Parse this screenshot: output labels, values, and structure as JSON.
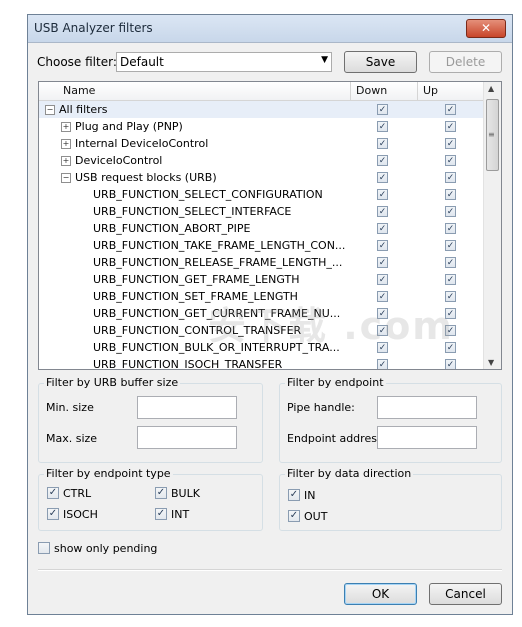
{
  "window": {
    "title": "USB Analyzer filters",
    "close_glyph": "✕"
  },
  "filter": {
    "label": "Choose filter:",
    "value": "Default",
    "save": "Save",
    "delete": "Delete"
  },
  "tree": {
    "columns": [
      "Name",
      "Down",
      "Up"
    ],
    "rows": [
      {
        "label": "All filters",
        "indent": 0,
        "expander": "−",
        "down": true,
        "up": true,
        "selected": true
      },
      {
        "label": "Plug and Play (PNP)",
        "indent": 1,
        "expander": "+",
        "down": true,
        "up": true
      },
      {
        "label": "Internal DeviceIoControl",
        "indent": 1,
        "expander": "+",
        "down": true,
        "up": true
      },
      {
        "label": "DeviceIoControl",
        "indent": 1,
        "expander": "+",
        "down": true,
        "up": true
      },
      {
        "label": "USB request blocks (URB)",
        "indent": 1,
        "expander": "−",
        "down": true,
        "up": true
      },
      {
        "label": "URB_FUNCTION_SELECT_CONFIGURATION",
        "indent": 2,
        "expander": "",
        "down": true,
        "up": true
      },
      {
        "label": "URB_FUNCTION_SELECT_INTERFACE",
        "indent": 2,
        "expander": "",
        "down": true,
        "up": true
      },
      {
        "label": "URB_FUNCTION_ABORT_PIPE",
        "indent": 2,
        "expander": "",
        "down": true,
        "up": true
      },
      {
        "label": "URB_FUNCTION_TAKE_FRAME_LENGTH_CON...",
        "indent": 2,
        "expander": "",
        "down": true,
        "up": true
      },
      {
        "label": "URB_FUNCTION_RELEASE_FRAME_LENGTH_...",
        "indent": 2,
        "expander": "",
        "down": true,
        "up": true
      },
      {
        "label": "URB_FUNCTION_GET_FRAME_LENGTH",
        "indent": 2,
        "expander": "",
        "down": true,
        "up": true
      },
      {
        "label": "URB_FUNCTION_SET_FRAME_LENGTH",
        "indent": 2,
        "expander": "",
        "down": true,
        "up": true
      },
      {
        "label": "URB_FUNCTION_GET_CURRENT_FRAME_NU...",
        "indent": 2,
        "expander": "",
        "down": true,
        "up": true
      },
      {
        "label": "URB_FUNCTION_CONTROL_TRANSFER",
        "indent": 2,
        "expander": "",
        "down": true,
        "up": true
      },
      {
        "label": "URB_FUNCTION_BULK_OR_INTERRUPT_TRA...",
        "indent": 2,
        "expander": "",
        "down": true,
        "up": true
      },
      {
        "label": "URB_FUNCTION_ISOCH_TRANSFER",
        "indent": 2,
        "expander": "",
        "down": true,
        "up": true
      }
    ]
  },
  "urb_size": {
    "legend": "Filter by URB buffer size",
    "min_label": "Min. size",
    "max_label": "Max. size",
    "min_value": "",
    "max_value": ""
  },
  "endpoint": {
    "legend": "Filter by endpoint",
    "pipe_label": "Pipe handle:",
    "address_label": "Endpoint address:",
    "pipe_value": "",
    "address_value": ""
  },
  "endpoint_type": {
    "legend": "Filter by endpoint type",
    "ctrl": "CTRL",
    "bulk": "BULK",
    "isoch": "ISOCH",
    "int": "INT"
  },
  "direction": {
    "legend": "Filter by data direction",
    "in": "IN",
    "out": "OUT"
  },
  "pending": {
    "label": "show only pending"
  },
  "footer": {
    "ok": "OK",
    "cancel": "Cancel"
  },
  "watermark": "安下载 .com",
  "check_glyph": "✓",
  "icons": {
    "close": "close-icon",
    "dropdown": "chevron-down-icon",
    "scroll_up": "arrow-up-icon",
    "scroll_down": "arrow-down-icon"
  }
}
